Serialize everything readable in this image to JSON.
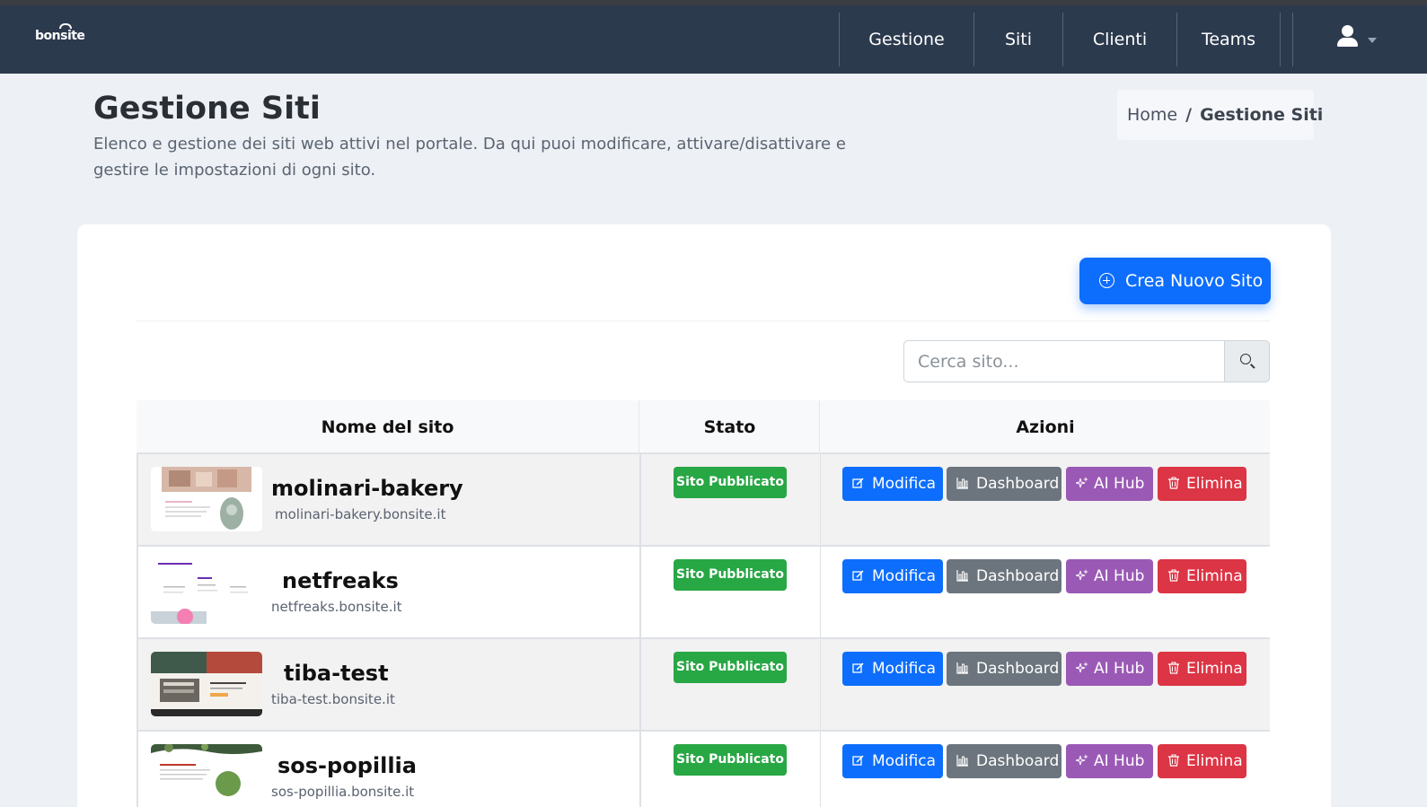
{
  "brand": {
    "name": "bonsite"
  },
  "nav": {
    "items": [
      {
        "label": "Gestione"
      },
      {
        "label": "Siti"
      },
      {
        "label": "Clienti"
      },
      {
        "label": "Teams"
      }
    ],
    "user_icon": "user-icon"
  },
  "header": {
    "title": "Gestione Siti",
    "description": "Elenco e gestione dei siti web attivi nel portale. Da qui puoi modificare, attivare/disattivare e gestire le impostazioni di ogni sito."
  },
  "breadcrumb": {
    "home": "Home",
    "separator": "/",
    "current": "Gestione Siti"
  },
  "create_button": {
    "label": "Crea Nuovo Sito",
    "icon": "plus-circle-icon"
  },
  "search": {
    "placeholder": "Cerca sito...",
    "value": "",
    "icon": "search-icon"
  },
  "table": {
    "headers": [
      "Nome del sito",
      "Stato",
      "Azioni"
    ],
    "actions": {
      "edit": "Modifica",
      "dashboard": "Dashboard",
      "ai_hub": "AI Hub",
      "delete": "Elimina"
    },
    "rows": [
      {
        "name": "molinari-bakery",
        "url": "molinari-bakery.bonsite.it",
        "status": "Sito Pubblicato"
      },
      {
        "name": "netfreaks",
        "url": "netfreaks.bonsite.it",
        "status": "Sito Pubblicato"
      },
      {
        "name": "tiba-test",
        "url": "tiba-test.bonsite.it",
        "status": "Sito Pubblicato"
      },
      {
        "name": "sos-popillia",
        "url": "sos-popillia.bonsite.it",
        "status": "Sito Pubblicato"
      }
    ]
  },
  "colors": {
    "navbar": "#2c3a4e",
    "primary": "#0d6efd",
    "success": "#28a745",
    "secondary": "#6c757d",
    "ai_purple": "#9b59b6",
    "danger": "#dc3545"
  }
}
